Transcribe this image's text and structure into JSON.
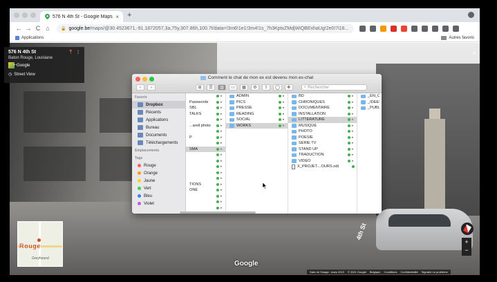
{
  "browser": {
    "tab_title": "576 N 4th St - Google Maps",
    "tab_close": "×",
    "new_tab": "+",
    "nav_back": "←",
    "nav_forward": "→",
    "nav_reload": "C",
    "nav_home": "⌂",
    "url_domain": "google.be",
    "url_rest": "/maps/@30.4523671,-91.1872057,3a,75y,307.86h,100.7t/data=!3m6!1e1!3m4!1s_7h3KptxZMdjWiQBExhaUg!2e0!7i16...",
    "bookmarks_apps": "Applications",
    "bookmarks_other": "Autres favoris",
    "toolbar_icon_colors": [
      "#5f6368",
      "#5f6368",
      "#f29900",
      "#d93025",
      "#ea4335",
      "#5f6368",
      "#5f6368",
      "#5f6368",
      "#5f6368",
      "#5f6368"
    ]
  },
  "streetview": {
    "address": "576 N 4th St",
    "city": "Baton Rouge, Louisiane",
    "provider": "Google",
    "mode_label": "Street View",
    "close": "×",
    "back": "←",
    "street_sign": "4th St",
    "minimap_text": "Rouge",
    "minimap_place": "Greyhound",
    "zoom_in": "+",
    "zoom_out": "−",
    "logo": "Google",
    "footer": [
      "Date de l'image : mars 2019",
      "© 2021 Google",
      "Belgique",
      "Conditions",
      "Confidentialité",
      "Signaler un problème"
    ]
  },
  "finder": {
    "title": "Comment le chat de mon ex est devenu mon ex-chat",
    "search_placeholder": "Rechercher",
    "toolbar": {
      "back": "‹",
      "forward": "›",
      "view_icons": "⊞",
      "view_list": "☰",
      "view_columns": "▥",
      "view_gallery": "▭",
      "group": "▦",
      "action": "⚙",
      "share": "⇧",
      "tag": "◯",
      "dropbox": "❖"
    },
    "sidebar": {
      "favorites_head": "Favoris",
      "favorites": [
        "Dropbox",
        "Récents",
        "Applications",
        "Bureau",
        "Documents",
        "Téléchargements"
      ],
      "locations_head": "Emplacements",
      "tags_head": "Tags",
      "tags": [
        {
          "name": "Rouge",
          "color": "#ff5f57"
        },
        {
          "name": "Orange",
          "color": "#ff9f0a"
        },
        {
          "name": "Jaune",
          "color": "#ffd60a"
        },
        {
          "name": "Vert",
          "color": "#32d74b"
        },
        {
          "name": "Bleu",
          "color": "#3a82f7"
        },
        {
          "name": "Violet",
          "color": "#bf5af2"
        }
      ]
    },
    "col1": [
      "",
      "Passwords",
      "SBL",
      "TALKS",
      "",
      "...areil photo",
      "",
      "P",
      "",
      "SMA",
      "",
      "",
      "",
      "",
      "",
      "TIONS",
      "ONE",
      "",
      "",
      "",
      "",
      "",
      ""
    ],
    "col2": [
      "ADMIN",
      "PICS",
      "PRESSE",
      "READING",
      "SOCIAL",
      "WORKS"
    ],
    "col3": [
      "BD",
      "CHRONIQUES",
      "DOCUMENTAIRE",
      "INSTALLATION",
      "LITTERATURE",
      "MUSIQUE",
      "PHOTO",
      "POESIE",
      "SERIE TV",
      "STAND UP",
      "TRADUCTION",
      "VIDEO",
      "X_PROJET....OURS.odt"
    ],
    "col4": [
      "_EN_CO",
      "_IDEES",
      "_PUBLIE"
    ]
  }
}
